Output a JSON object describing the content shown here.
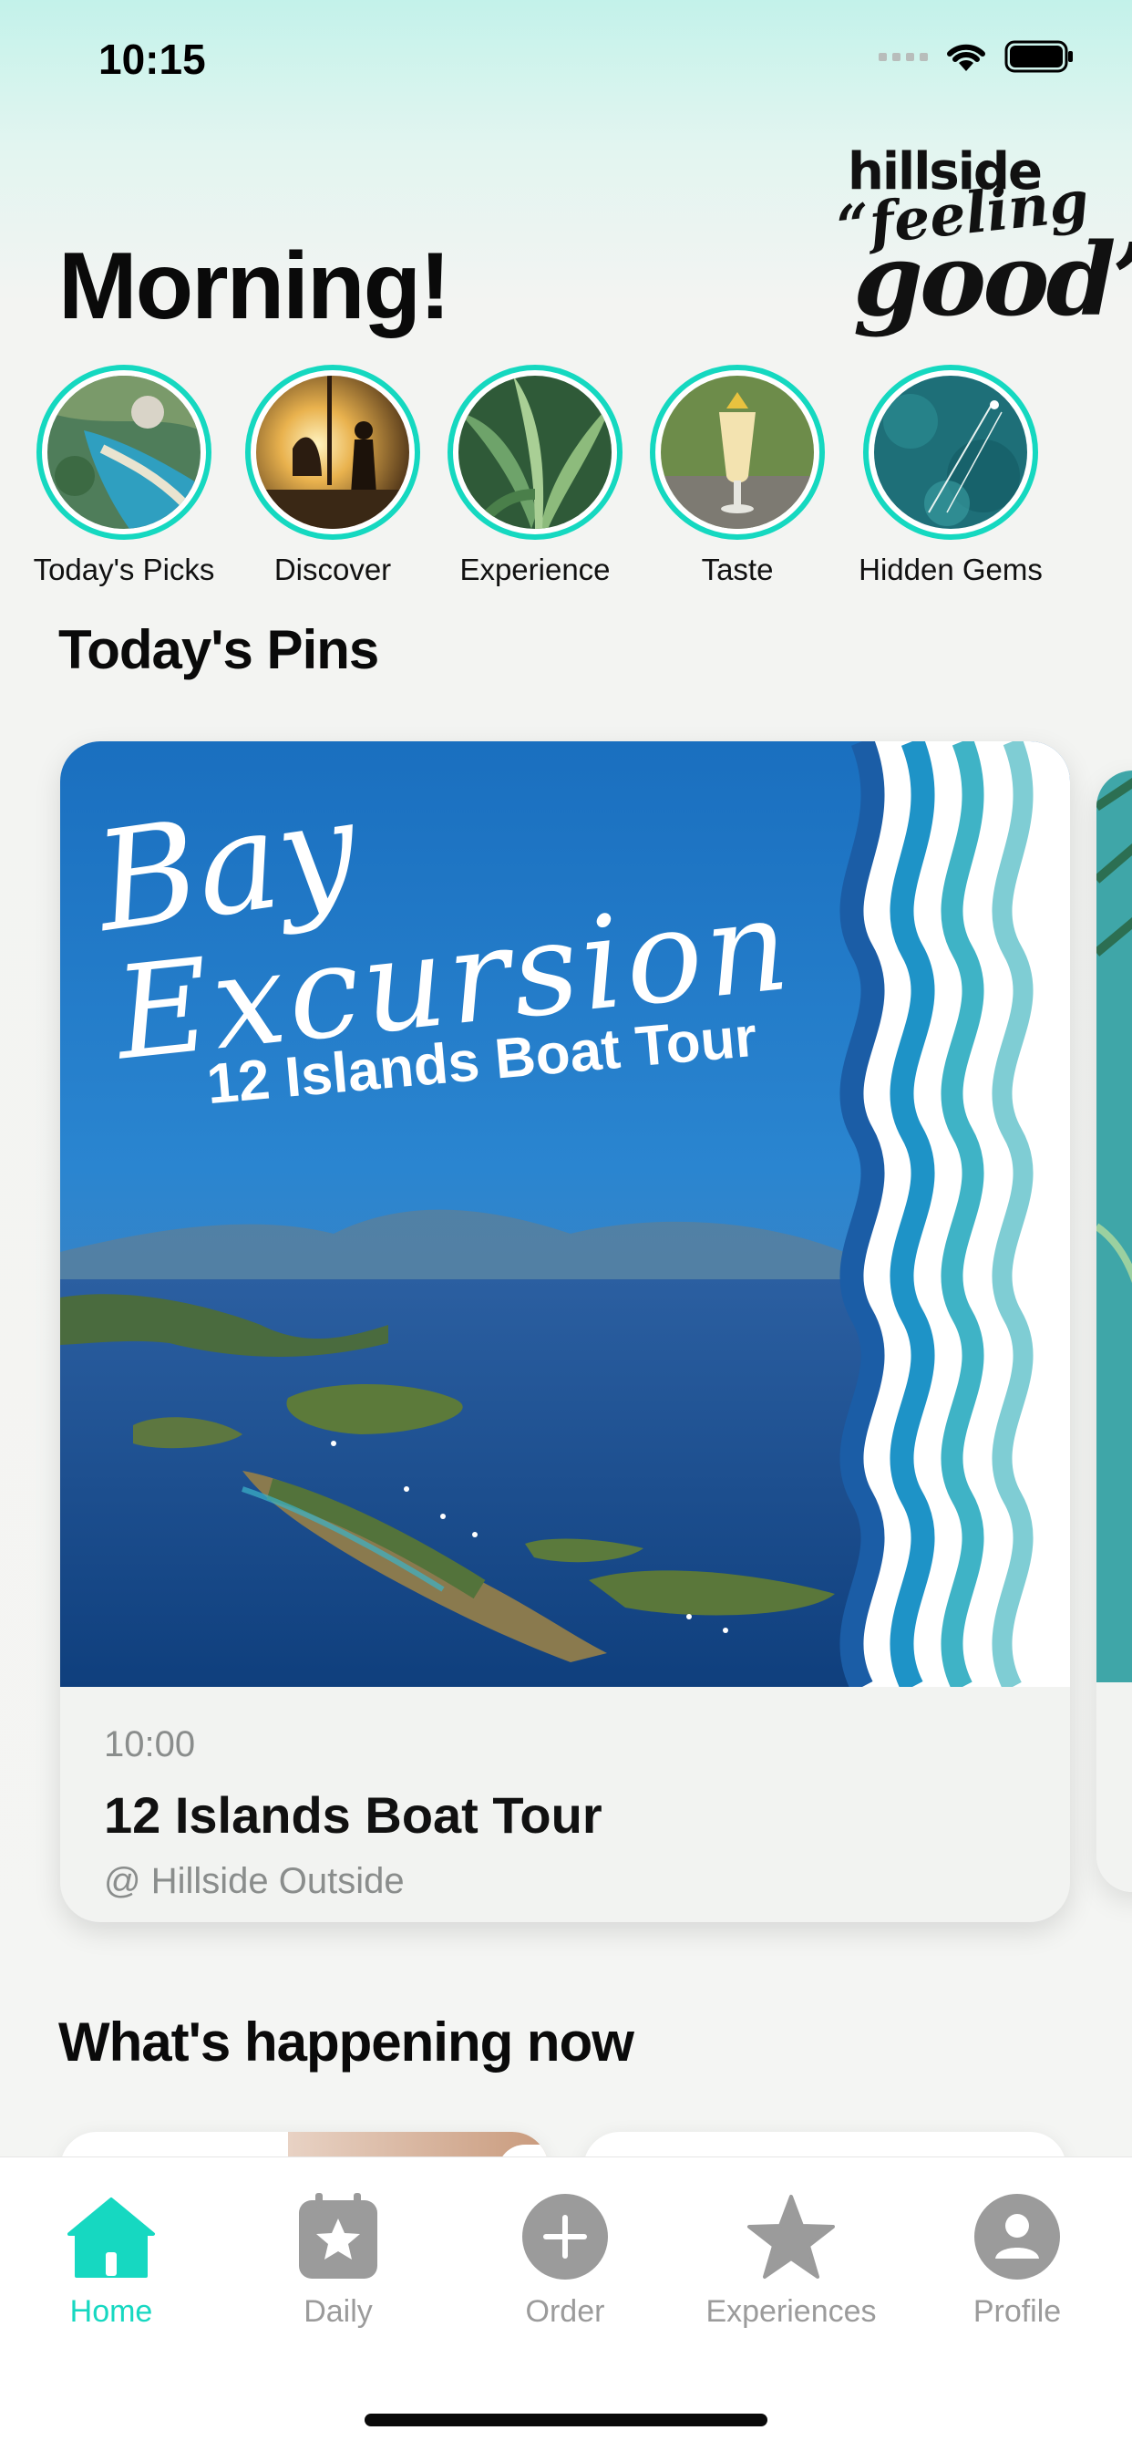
{
  "status_bar": {
    "time": "10:15"
  },
  "logo": {
    "line1": "hillside",
    "line2": "“feeling",
    "line3": "good”"
  },
  "greeting": "Morning!",
  "stories": [
    {
      "label": "Today's Picks"
    },
    {
      "label": "Discover"
    },
    {
      "label": "Experience"
    },
    {
      "label": "Taste"
    },
    {
      "label": "Hidden Gems"
    }
  ],
  "pins_section": {
    "title": "Today's Pins"
  },
  "pin_card": {
    "banner_script_1": "Bay",
    "banner_script_2": "Excursion",
    "banner_subtitle": "12 Islands Boat Tour",
    "time": "10:00",
    "title": "12 Islands Boat Tour",
    "venue": "@ Hillside Outside"
  },
  "happening_section": {
    "title": "What's happening now"
  },
  "tabbar": {
    "items": [
      {
        "label": "Home",
        "icon": "home-icon",
        "active": true
      },
      {
        "label": "Daily",
        "icon": "calendar-star-icon"
      },
      {
        "label": "Order",
        "icon": "plus-circle-icon"
      },
      {
        "label": "Experiences",
        "icon": "star-icon"
      },
      {
        "label": "Profile",
        "icon": "user-circle-icon"
      }
    ]
  },
  "colors": {
    "accent": "#16d8c1",
    "inactive": "#9b9b9b"
  }
}
